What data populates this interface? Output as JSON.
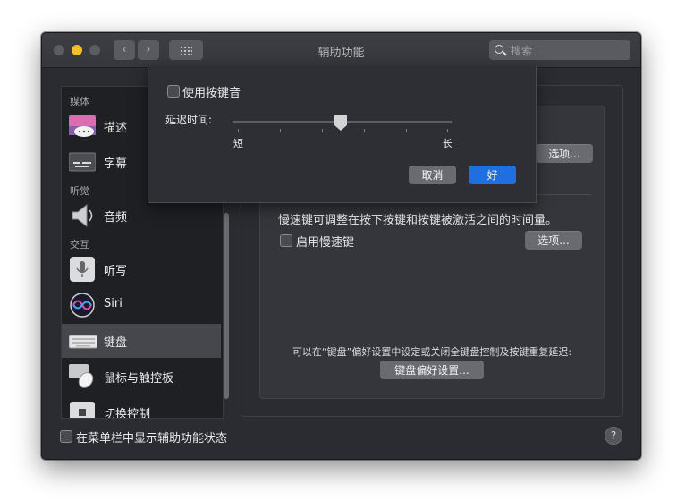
{
  "window": {
    "title": "辅助功能",
    "search_placeholder": "搜索",
    "nav_back": "‹",
    "nav_forward": "›"
  },
  "sidebar": {
    "sections": [
      "媒体",
      "听觉",
      "交互"
    ],
    "items": [
      {
        "label": "描述",
        "icon": "speech-bubble-icon"
      },
      {
        "label": "字幕",
        "icon": "captions-icon"
      },
      {
        "label": "音频",
        "icon": "speaker-icon"
      },
      {
        "label": "听写",
        "icon": "microphone-icon"
      },
      {
        "label": "Siri",
        "icon": "siri-icon"
      },
      {
        "label": "键盘",
        "icon": "keyboard-icon",
        "selected": true
      },
      {
        "label": "鼠标与触控板",
        "icon": "mouse-icon"
      },
      {
        "label": "切换控制",
        "icon": "switch-control-icon"
      }
    ]
  },
  "content": {
    "options_button_top": "选项...",
    "slow_keys_desc": "慢速键可调整在按下按键和按键被激活之间的时间量。",
    "enable_slow_keys": "启用慢速键",
    "enable_slow_keys_checked": false,
    "options_button_slow": "选项...",
    "note": "可以在“键盘”偏好设置中设定或关闭全键盘控制及按键重复延迟:",
    "keyboard_prefs_button": "键盘偏好设置..."
  },
  "footer": {
    "show_status_label": "在菜单栏中显示辅助功能状态",
    "show_status_checked": false,
    "help": "?"
  },
  "sheet": {
    "use_key_sound": "使用按键音",
    "use_key_sound_checked": false,
    "delay_label": "延迟时间:",
    "slider_min_label": "短",
    "slider_max_label": "长",
    "slider_value_fraction": 0.48,
    "cancel": "取消",
    "ok": "好"
  },
  "colors": {
    "accent": "#1f6fe0",
    "minimize": "#f5bf2f",
    "window_bg": "#2b2c31"
  }
}
